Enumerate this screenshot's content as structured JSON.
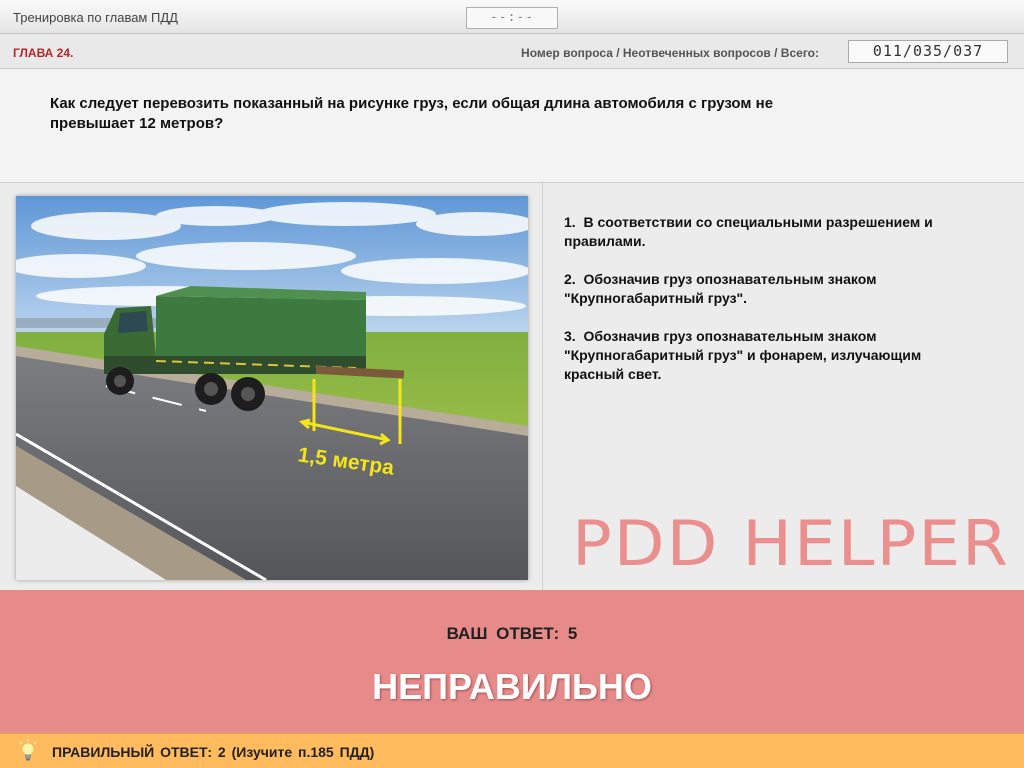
{
  "header": {
    "app_title": "Тренировка по главам ПДД",
    "timer": "--:--"
  },
  "chapter": {
    "label": "ГЛАВА 24.",
    "counter_label": "Номер вопроса / Неотвеченных вопросов / Всего:",
    "counter_value": "011/035/037"
  },
  "question": {
    "text_line1": "Как следует перевозить показанный на рисунке груз, если общая длина автомобиля с грузом не",
    "text_line2": "превышает 12 метров?",
    "image_label": "1,5 метра"
  },
  "answers": [
    {
      "num": "1.",
      "text_line1": "В соответствии со специальными разрешением и",
      "text_line2": "правилами."
    },
    {
      "num": "2.",
      "text_line1": "Обозначив груз опознавательным знаком",
      "text_line2": "\"Крупногабаритный груз\"."
    },
    {
      "num": "3.",
      "text_line1": "Обозначив груз опознавательным знаком",
      "text_line2": "\"Крупногабаритный груз\" и фонарем, излучающим",
      "text_line3": "красный свет."
    }
  ],
  "watermark": "PDD HELPER",
  "result": {
    "your_answer_label": "ВАШ ОТВЕТ:",
    "your_answer_value": "5",
    "verdict": "НЕПРАВИЛЬНО",
    "verdict_color": "#e68a8a"
  },
  "correct": {
    "label": "ПРАВИЛЬНЫЙ ОТВЕТ:",
    "value": "2",
    "hint": "(Изучите п.185 ПДД)",
    "icon": "lightbulb-icon",
    "bar_color": "#ffbb5e"
  }
}
